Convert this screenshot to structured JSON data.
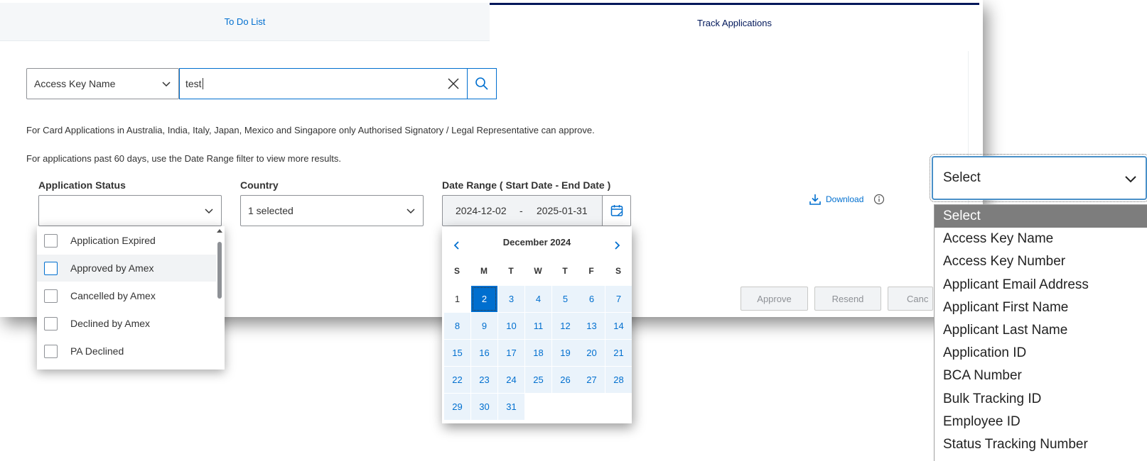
{
  "tabs": [
    {
      "label": "To Do List",
      "active": false
    },
    {
      "label": "Track Applications",
      "active": true
    }
  ],
  "search": {
    "type_value": "Access Key Name",
    "input_value": "test"
  },
  "notes": {
    "line1": "For Card Applications in Australia, India, Italy, Japan, Mexico and Singapore only Authorised Signatory / Legal Representative can approve.",
    "line2": "For applications past 60 days, use the Date Range filter to view more results."
  },
  "filters": {
    "status_label": "Application Status",
    "status_value": "",
    "country_label": "Country",
    "country_value": "1 selected",
    "date_label": "Date Range ( Start Date - End Date )",
    "date_start": "2024-12-02",
    "date_sep": "-",
    "date_end": "2025-01-31"
  },
  "download_label": "Download",
  "actions": {
    "approve": "Approve",
    "resend": "Resend",
    "cancel": "Canc"
  },
  "status_options": [
    {
      "label": "Application Expired",
      "checked": false
    },
    {
      "label": "Approved by Amex",
      "checked": false
    },
    {
      "label": "Cancelled by Amex",
      "checked": false
    },
    {
      "label": "Declined by Amex",
      "checked": false
    },
    {
      "label": "PA Declined",
      "checked": false
    }
  ],
  "calendar": {
    "title": "December 2024",
    "weekdays": [
      "S",
      "M",
      "T",
      "W",
      "T",
      "F",
      "S"
    ],
    "days": [
      "1",
      "2",
      "3",
      "4",
      "5",
      "6",
      "7",
      "8",
      "9",
      "10",
      "11",
      "12",
      "13",
      "14",
      "15",
      "16",
      "17",
      "18",
      "19",
      "20",
      "21",
      "22",
      "23",
      "24",
      "25",
      "26",
      "27",
      "28",
      "29",
      "30",
      "31"
    ],
    "selected_day": "2",
    "out_of_range_days": [
      "1"
    ]
  },
  "select_dropdown": {
    "current": "Select",
    "options": [
      "Select",
      "Access Key Name",
      "Access Key Number",
      "Applicant Email Address",
      "Applicant First Name",
      "Applicant Last Name",
      "Application ID",
      "BCA Number",
      "Bulk Tracking ID",
      "Employee ID",
      "Status Tracking Number"
    ],
    "highlighted": "Select"
  },
  "colors": {
    "brand_blue": "#006fcf",
    "navy": "#00175a",
    "calendar_range": "#eaf3fb",
    "dropdown_highlight": "#7d7d7d"
  },
  "icons": [
    "chevron-down-icon",
    "close-icon",
    "search-icon",
    "calendar-icon",
    "download-icon",
    "info-icon",
    "chevron-left-icon",
    "chevron-right-icon",
    "scroll-up-icon"
  ]
}
